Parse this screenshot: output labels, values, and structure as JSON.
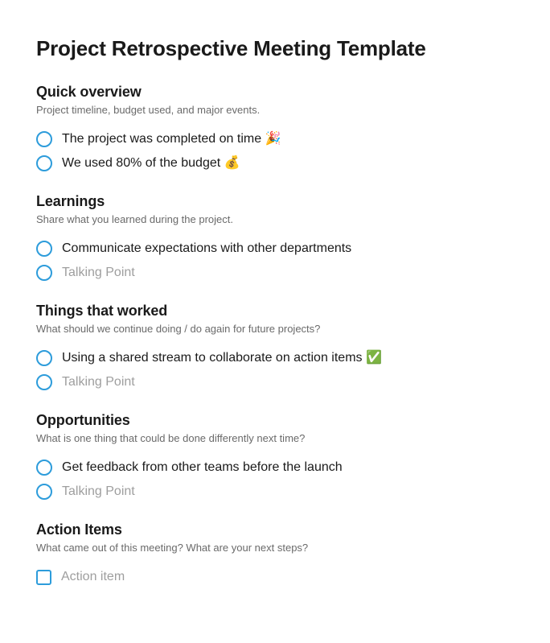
{
  "title": "Project Retrospective Meeting Template",
  "sections": [
    {
      "title": "Quick overview",
      "desc": "Project timeline, budget used, and major events.",
      "items": [
        {
          "text": "The project was completed on time 🎉",
          "placeholder": false,
          "shape": "circle"
        },
        {
          "text": "We used 80% of the budget 💰",
          "placeholder": false,
          "shape": "circle"
        }
      ]
    },
    {
      "title": "Learnings",
      "desc": "Share what you learned during the project.",
      "items": [
        {
          "text": "Communicate expectations with other departments",
          "placeholder": false,
          "shape": "circle"
        },
        {
          "text": "Talking Point",
          "placeholder": true,
          "shape": "circle"
        }
      ]
    },
    {
      "title": "Things that worked",
      "desc": "What should we continue doing / do again for future projects?",
      "items": [
        {
          "text": "Using a shared stream to collaborate on action items ✅",
          "placeholder": false,
          "shape": "circle"
        },
        {
          "text": "Talking Point",
          "placeholder": true,
          "shape": "circle"
        }
      ]
    },
    {
      "title": "Opportunities",
      "desc": "What is one thing that could be done differently next time?",
      "items": [
        {
          "text": "Get feedback from other teams before the launch",
          "placeholder": false,
          "shape": "circle"
        },
        {
          "text": "Talking Point",
          "placeholder": true,
          "shape": "circle"
        }
      ]
    },
    {
      "title": "Action Items",
      "desc": "What came out of this meeting? What are your next steps?",
      "items": [
        {
          "text": "Action item",
          "placeholder": true,
          "shape": "square"
        }
      ]
    }
  ]
}
